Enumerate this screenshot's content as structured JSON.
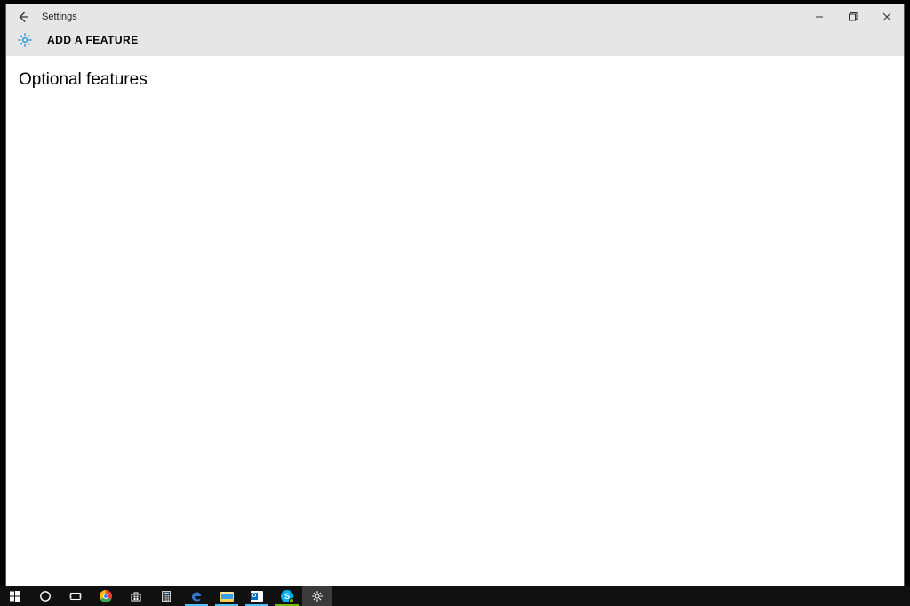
{
  "window": {
    "app_title": "Settings",
    "subheader_title": "ADD A FEATURE"
  },
  "content": {
    "heading": "Optional features"
  },
  "taskbar": {
    "items": [
      "start",
      "cortana",
      "taskview",
      "chrome",
      "store",
      "calculator",
      "edge",
      "file-explorer",
      "outlook",
      "skype",
      "settings"
    ]
  },
  "colors": {
    "header_bg": "#e6e6e6",
    "gear_accent": "#0a84d6",
    "taskbar_bg": "#101010"
  }
}
